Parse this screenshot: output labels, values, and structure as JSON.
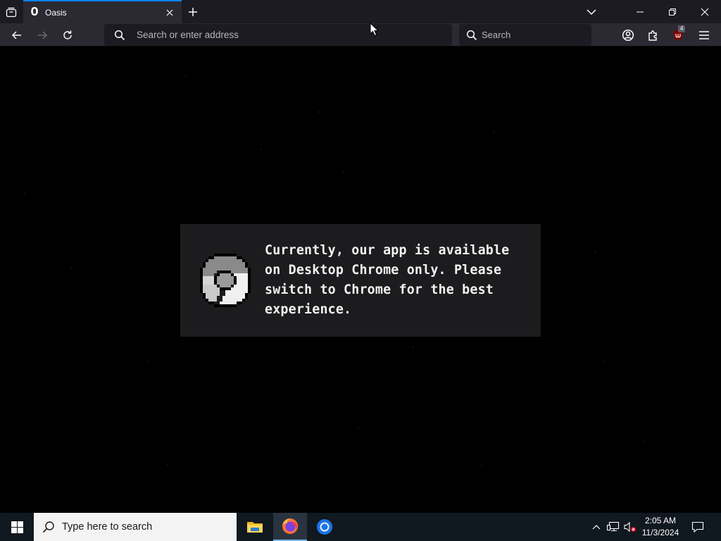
{
  "browser": {
    "tab": {
      "favicon_text": "O",
      "title": "Oasis"
    },
    "urlbar": {
      "placeholder": "Search or enter address"
    },
    "searchbar": {
      "placeholder": "Search"
    },
    "extensions_badge": "4",
    "accent_color": "#0a84ff"
  },
  "page": {
    "notice_text": "Currently, our app is available on Desktop Chrome only. Please switch to Chrome for the best experience.",
    "notice_icon": "chrome-icon-pixel-grayscale"
  },
  "taskbar": {
    "search_placeholder": "Type here to search",
    "apps": [
      "file-explorer",
      "firefox",
      "chrome"
    ],
    "clock_time": "2:05 AM",
    "clock_date": "11/3/2024"
  }
}
